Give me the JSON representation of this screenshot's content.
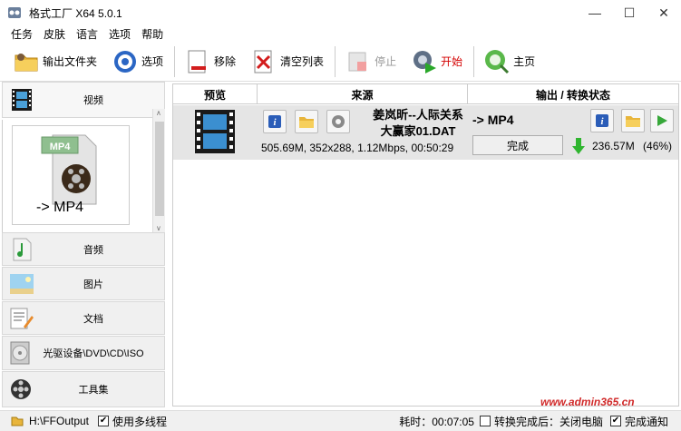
{
  "window": {
    "title": "格式工厂 X64 5.0.1",
    "minimize_glyph": "—",
    "maximize_glyph": "☐",
    "close_glyph": "✕"
  },
  "menu": [
    "任务",
    "皮肤",
    "语言",
    "选项",
    "帮助"
  ],
  "toolbar": {
    "output_folder": "输出文件夹",
    "options": "选项",
    "remove": "移除",
    "clear_list": "清空列表",
    "stop": "停止",
    "start": "开始",
    "home": "主页"
  },
  "categories": {
    "video": "视频",
    "audio": "音频",
    "image": "图片",
    "document": "文档",
    "disc": "光驱设备\\DVD\\CD\\ISO",
    "tools": "工具集"
  },
  "video_panel": {
    "format_badge": "MP4",
    "target_label": "-> MP4"
  },
  "table": {
    "headers": [
      "预览",
      "来源",
      "输出 / 转换状态"
    ],
    "row": {
      "source_name_line1": "姜岚昕--人际关系",
      "source_name_line2": "大赢家01.DAT",
      "source_meta": "505.69M, 352x288, 1.12Mbps, 00:50:29",
      "output_format": "-> MP4",
      "status_button": "完成",
      "output_size": "236.57M",
      "progress_text": "(46%)"
    }
  },
  "statusbar": {
    "output_path": "H:\\FFOutput",
    "multithread_label": "使用多线程",
    "multithread_checked": true,
    "elapsed": "耗时：00:07:05",
    "after_convert_label": "转换完成后：关闭电脑",
    "after_convert_checked": false,
    "notify_label": "完成通知",
    "notify_checked": true
  },
  "watermark": "www.admin365.cn"
}
